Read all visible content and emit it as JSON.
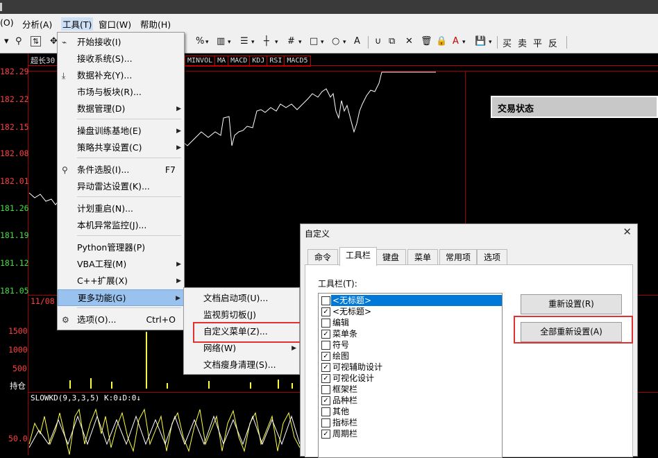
{
  "menubar": {
    "items": [
      "(O)",
      "分析(A)",
      "工具(T)",
      "窗口(W)",
      "帮助(H)"
    ]
  },
  "toolbar": {
    "items": [
      "%",
      "A",
      "买",
      "卖",
      "平",
      "反"
    ]
  },
  "chart": {
    "header_label": "超长30",
    "indicator_tabs": [
      "MINVOL",
      "MA",
      "MACD",
      "KDJ",
      "RSI",
      "MACD5"
    ],
    "price_labels": [
      "182.29",
      "182.22",
      "182.15",
      "182.08",
      "182.01",
      "181.26",
      "181.19",
      "181.12",
      "181.05"
    ],
    "date_label": "11/08",
    "volume_labels": [
      "1500",
      "1000",
      "500"
    ],
    "volume_caption": "持仓",
    "kd_label": "SLOWKD(9,3,3,5) K:0↓D:0↓",
    "kd_value": "50.0",
    "status_box": "交易状态",
    "colors": {
      "up": "#ff4040",
      "down": "#40e040",
      "grid": "#a00000",
      "line": "#ffffff",
      "kd": "#ffff40"
    }
  },
  "tools_menu": {
    "items": [
      {
        "label": "开始接收(I)",
        "icon": "plug-icon"
      },
      {
        "label": "接收系统(S)..."
      },
      {
        "label": "数据补充(Y)...",
        "icon": "download-icon"
      },
      {
        "label": "市场与板块(R)..."
      },
      {
        "label": "数据管理(D)",
        "submenu": true
      },
      {
        "label": "操盘训练基地(E)",
        "submenu": true
      },
      {
        "label": "策略共享设置(C)",
        "submenu": true
      },
      {
        "label": "条件选股(I)...",
        "shortcut": "F7",
        "icon": "filter-icon"
      },
      {
        "label": "异动雷达设置(K)..."
      },
      {
        "label": "计划重启(N)..."
      },
      {
        "label": "本机异常监控(J)..."
      },
      {
        "label": "Python管理器(P)"
      },
      {
        "label": "VBA工程(M)",
        "submenu": true
      },
      {
        "label": "C++扩展(X)",
        "submenu": true
      },
      {
        "label": "更多功能(G)",
        "submenu": true
      },
      {
        "label": "选项(O)...",
        "shortcut": "Ctrl+O",
        "icon": "gear-icon"
      }
    ]
  },
  "more_menu": {
    "items": [
      {
        "label": "文档启动项(U)..."
      },
      {
        "label": "监视剪切板(J)"
      },
      {
        "label": "自定义菜单(Z)..."
      },
      {
        "label": "网络(W)",
        "submenu": true
      },
      {
        "label": "文档瘦身清理(S)..."
      }
    ]
  },
  "dialog": {
    "title": "自定义",
    "close": "✕",
    "tabs": [
      "命令",
      "工具栏",
      "键盘",
      "菜单",
      "常用项",
      "选项"
    ],
    "active_tab": "工具栏",
    "list_label": "工具栏(T):",
    "toolbars": [
      {
        "label": "<无标题>",
        "checked": false,
        "selected": true
      },
      {
        "label": "<无标题>",
        "checked": true
      },
      {
        "label": "编辑",
        "checked": false
      },
      {
        "label": "菜单条",
        "checked": true
      },
      {
        "label": "符号",
        "checked": false
      },
      {
        "label": "绘图",
        "checked": true
      },
      {
        "label": "可视辅助设计",
        "checked": true
      },
      {
        "label": "可视化设计",
        "checked": true
      },
      {
        "label": "框架栏",
        "checked": false
      },
      {
        "label": "品种栏",
        "checked": true
      },
      {
        "label": "其他",
        "checked": false
      },
      {
        "label": "指标栏",
        "checked": false
      },
      {
        "label": "周期栏",
        "checked": true
      }
    ],
    "reset_button": "重新设置(R)",
    "reset_all_button": "全部重新设置(A)"
  }
}
